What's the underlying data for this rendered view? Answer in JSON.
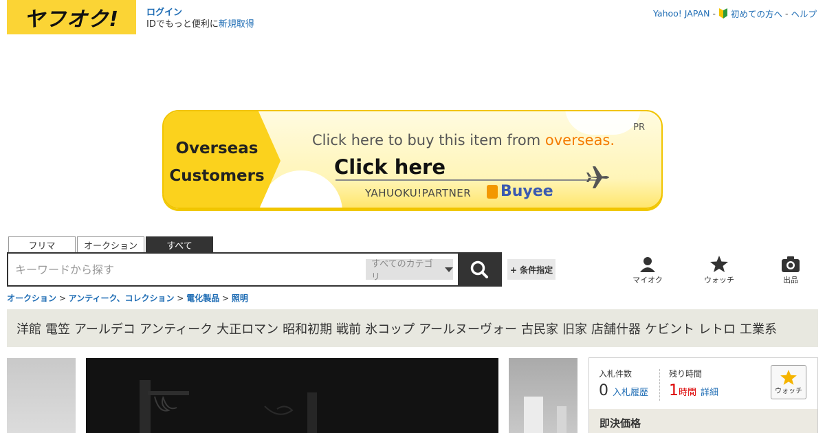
{
  "header": {
    "logo_text": "ヤフオク!",
    "login_label": "ログイン",
    "login_sub_prefix": "IDでもっと便利に",
    "register_label": "新規取得",
    "yahoo_japan": "Yahoo! JAPAN",
    "sep": "-",
    "first_time": "初めての方へ",
    "help": "ヘルプ"
  },
  "banner": {
    "left_line1": "Overseas",
    "left_line2": "Customers",
    "line1_prefix": "Click here to buy this item from ",
    "line1_accent": "overseas.",
    "click_here": "Click here",
    "partner": "YAHUOKU!PARTNER",
    "buyee": "Buyee",
    "pr": "PR"
  },
  "search": {
    "tabs": [
      "フリマ",
      "オークション",
      "すべて"
    ],
    "active_tab": "すべて",
    "placeholder": "キーワードから探す",
    "category": "すべてのカテゴリ",
    "condition_button": "+ 条件指定"
  },
  "icon_links": [
    {
      "label": "マイオク",
      "icon": "person-icon"
    },
    {
      "label": "ウォッチ",
      "icon": "star-icon"
    },
    {
      "label": "出品",
      "icon": "camera-icon"
    }
  ],
  "breadcrumb": [
    "オークション",
    "アンティーク、コレクション",
    "電化製品",
    "照明"
  ],
  "breadcrumb_sep": ">",
  "keywords": [
    "洋館",
    "電笠",
    "アールデコ",
    "アンティーク",
    "大正ロマン",
    "昭和初期",
    "戦前",
    "氷コップ",
    "アールヌーヴォー",
    "古民家",
    "旧家",
    "店舗什器",
    "ケビント",
    "レトロ",
    "工業系"
  ],
  "bid": {
    "bids_label": "入札件数",
    "bids_count": "0",
    "bid_history": "入札履歴",
    "time_label": "残り時間",
    "time_value": "1",
    "time_unit": "時間",
    "detail": "詳細",
    "watch": "ウォッチ",
    "buy_now": "即決価格"
  },
  "colors": {
    "brand_yellow": "#fbd435",
    "link_blue": "#1e6cb4",
    "accent_orange": "#f47b00",
    "time_red": "#dd0000"
  }
}
